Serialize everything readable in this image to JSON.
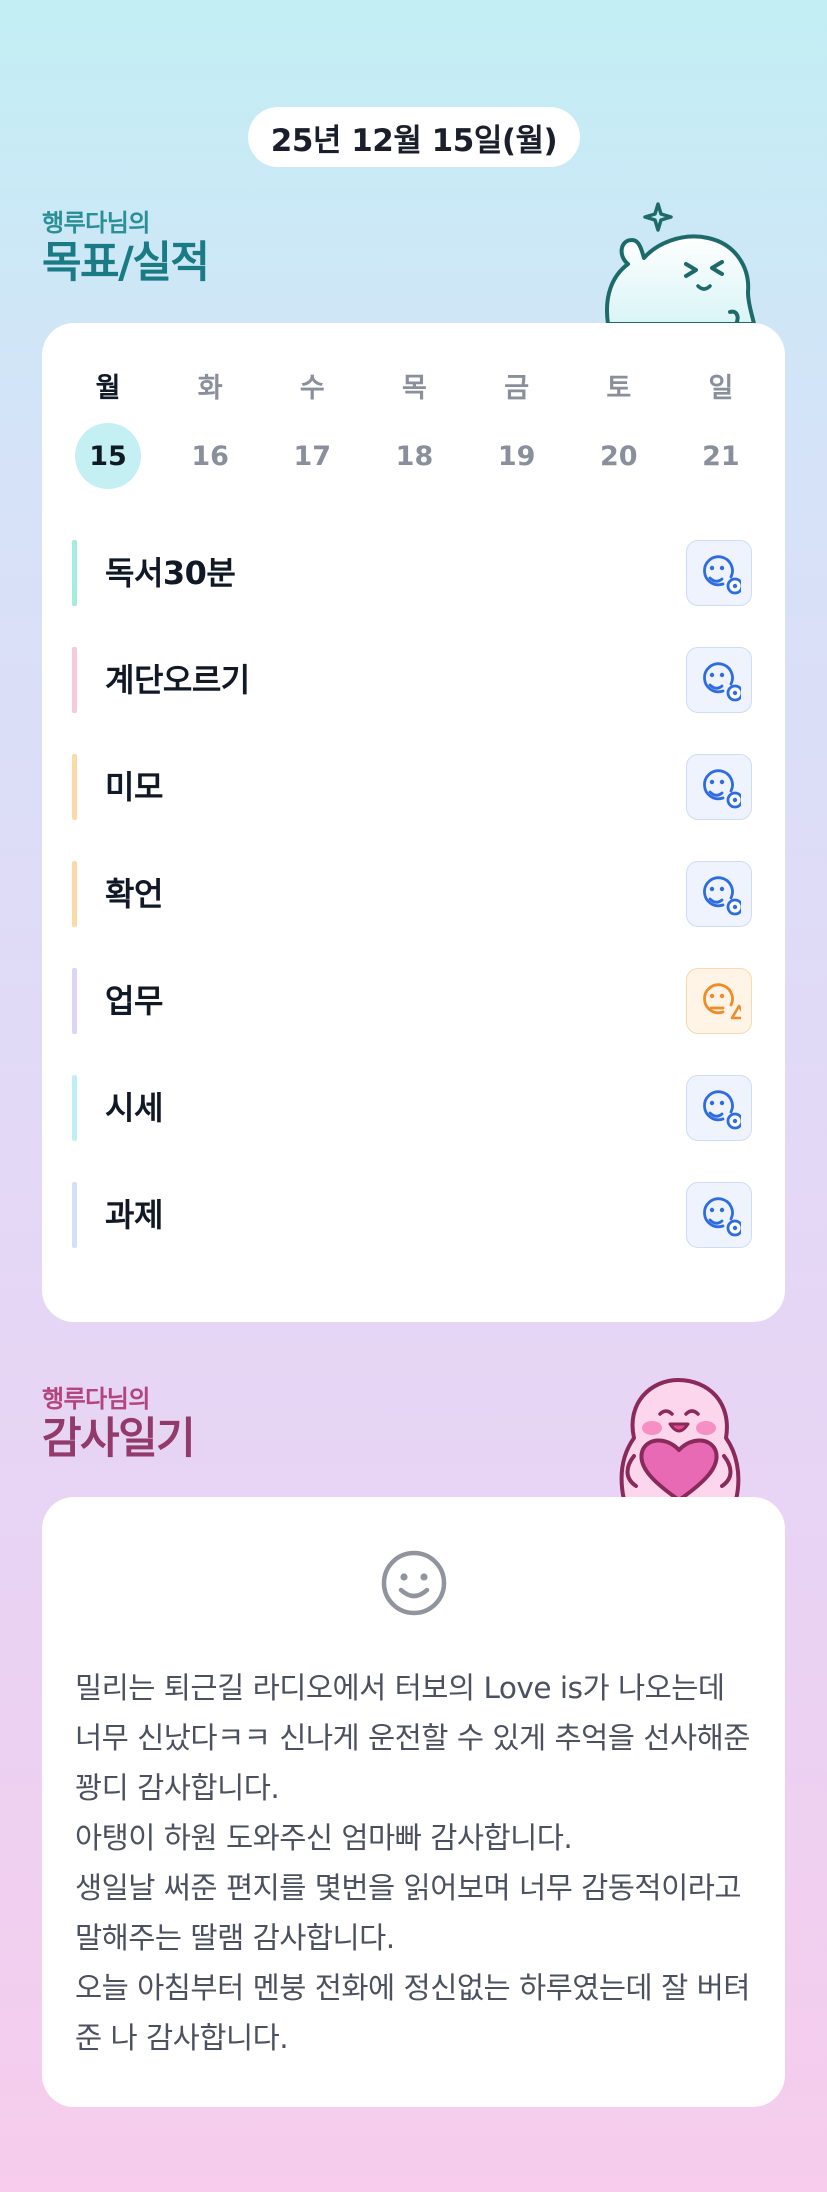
{
  "header": {
    "date": "25년 12월 15일(월)"
  },
  "goals_section": {
    "owner_label": "행루다님의",
    "title": "목표/실적",
    "week": [
      {
        "day": "월",
        "date": "15",
        "selected": true
      },
      {
        "day": "화",
        "date": "16",
        "selected": false
      },
      {
        "day": "수",
        "date": "17",
        "selected": false
      },
      {
        "day": "목",
        "date": "18",
        "selected": false
      },
      {
        "day": "금",
        "date": "19",
        "selected": false
      },
      {
        "day": "토",
        "date": "20",
        "selected": false
      },
      {
        "day": "일",
        "date": "21",
        "selected": false
      }
    ],
    "goals": [
      {
        "name": "독서30분",
        "color": "#a6ecdc",
        "status_icon": "smile-check-icon",
        "status": "done"
      },
      {
        "name": "계단오르기",
        "color": "#f8c8dc",
        "status_icon": "smile-check-icon",
        "status": "done"
      },
      {
        "name": "미모",
        "color": "#fbd9a8",
        "status_icon": "smile-check-icon",
        "status": "done"
      },
      {
        "name": "확언",
        "color": "#fbd9a8",
        "status_icon": "smile-check-icon",
        "status": "done"
      },
      {
        "name": "업무",
        "color": "#ddd4f6",
        "status_icon": "smile-warning-icon",
        "status": "warning"
      },
      {
        "name": "시세",
        "color": "#bfeef6",
        "status_icon": "smile-check-icon",
        "status": "done"
      },
      {
        "name": "과제",
        "color": "#d6e0f5",
        "status_icon": "smile-check-icon",
        "status": "done"
      }
    ]
  },
  "thanks_section": {
    "owner_label": "행루다님의",
    "title": "감사일기",
    "mood_icon": "smiley-face-icon",
    "entry": "밀리는 퇴근길 라디오에서 터보의 Love is가 나오는데 너무 신났다ㅋㅋ 신나게 운전할 수 있게 추억을 선사해준 꽝디 감사합니다.\n아탱이 하원 도와주신 엄마빠 감사합니다.\n생일날 써준 편지를 몇번을 읽어보며 너무 감동적이라고 말해주는 딸램 감사합니다.\n오늘 아침부터 멘붕 전화에 정신없는 하루였는데 잘 버텨준 나 감사합니다."
  },
  "colors": {
    "accent_teal": "#1a7b85",
    "accent_plum": "#933a6c",
    "status_blue": "#2f6ce0",
    "status_orange": "#f08c28",
    "selected_day_bg": "#c4eff3"
  }
}
